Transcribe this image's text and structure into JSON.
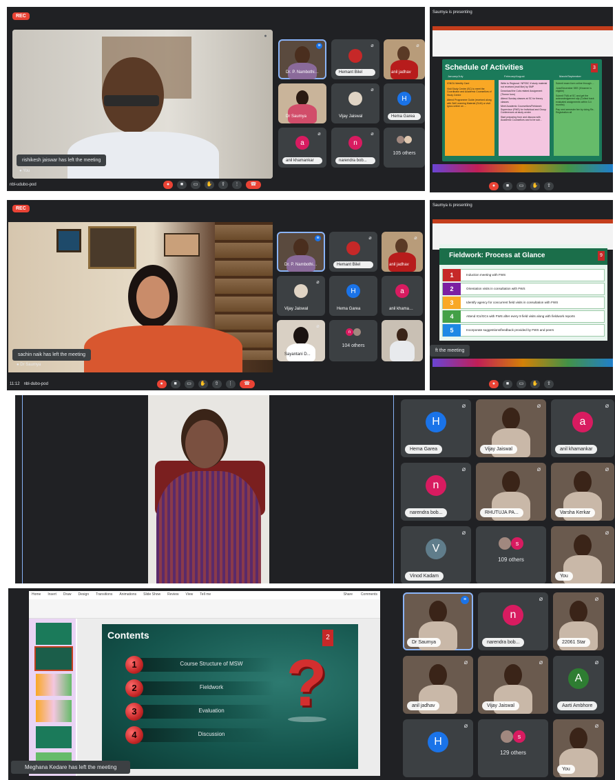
{
  "p1": {
    "rec": "REC",
    "toast": "rishikesh jaiswar has left the meeting",
    "self_label": "You",
    "footer": "nbl-udubo-pod",
    "tiles": [
      {
        "name": "Dr. P. Nambothiri...",
        "active": true
      },
      {
        "name": "Hemant Bilel",
        "avatar": "photo"
      },
      {
        "name": "anil jadhav"
      },
      {
        "name": "Dr Saumya"
      },
      {
        "name": "Vijay Jaiswal"
      },
      {
        "name": "Hema Garea",
        "letter": "H",
        "color": "#1a73e8"
      },
      {
        "name": "anil khamankar",
        "letter": "a",
        "color": "#d81b60"
      },
      {
        "name": "narendra bob...",
        "letter": "n",
        "color": "#d81b60"
      },
      {
        "name": "105 others"
      }
    ]
  },
  "p2": {
    "header": "Saumya is presenting",
    "slide_title": "Schedule of Activities",
    "columns": [
      "January/July",
      "February/August",
      "March/September"
    ],
    "col1": [
      "IGNOU Identity Card",
      "Visit Study Centre (SC) to meet the Coordinator and Academic Counsellors of Study Centre",
      "Attend Programme Guide (received along with Self Learning Material (SLM) or visit ignou online on ..."
    ],
    "col2": [
      "Write to Regional / NPSSC if study material not received (mail like) by SMP",
      "Download the Cuts related Assignment (Theme form)",
      "Attend Sunday classes at SC for theory classes",
      "Meet Academic Counsellors/Fieldwork Supervisor (FWS) for Individual and Group Conferences at study centre",
      "Start preparing from and discuss with Academic Counsellors and to be sub..."
    ],
    "col3": [
      "Submit exam form online through ...",
      "June/December SEE (if learner is eligible)",
      "Submit TMA at SC and get the acknowledgement slip (Collect back evaluated assignments within 3-4 months)",
      "Pay next semester fee by doing Re-Registration all"
    ],
    "slide_no": "3"
  },
  "p3": {
    "rec": "REC",
    "toast": "sachin naik has left the meeting",
    "self_label": "Dr Saumya",
    "time": "11:12",
    "footer": "nbl-dubo-pod",
    "tiles": [
      {
        "name": "Dr. P. Nambothiri...",
        "active": true
      },
      {
        "name": "Hemant Bilel",
        "avatar": "photo"
      },
      {
        "name": "anil jadhav"
      },
      {
        "name": "Vijay Jaiswal"
      },
      {
        "name": "Hema Garea",
        "letter": "H",
        "color": "#1a73e8"
      },
      {
        "name": "anil khamankar",
        "letter": "a",
        "color": "#d81b60"
      },
      {
        "name": "Sayantani D..."
      },
      {
        "name": "104 others"
      },
      {
        "name": ""
      }
    ]
  },
  "p4": {
    "header": "Saumya is presenting",
    "slide_title": "Fieldwork: Process at Glance",
    "slide_no": "9",
    "toast": "ft the meeting",
    "rows": [
      {
        "n": "1",
        "color": "#c62828",
        "text": "Induction meeting with FWS"
      },
      {
        "n": "2",
        "color": "#7b1fa2",
        "text": "Orientation visits in consultation with FWS"
      },
      {
        "n": "3",
        "color": "#f9a825",
        "text": "Identify agency for concurrent field visits in consultation with FWS"
      },
      {
        "n": "4",
        "color": "#43a047",
        "text": "Attend ICs/GCs with FWS after every 9 field visits along with fieldwork reports"
      },
      {
        "n": "5",
        "color": "#1e88e5",
        "text": "Incorporate suggestions/feedback provided by FWS and peers"
      }
    ]
  },
  "p5": {
    "tiles": [
      {
        "name": "Hema Garea",
        "letter": "H",
        "color": "#1a73e8"
      },
      {
        "name": "Vijay Jaiswal"
      },
      {
        "name": "anil khamankar",
        "letter": "a",
        "color": "#d81b60"
      },
      {
        "name": "narendra bob...",
        "letter": "n",
        "color": "#d81b60"
      },
      {
        "name": "RHUTUJA PA..."
      },
      {
        "name": "Varsha Kerkar"
      },
      {
        "name": "Vinod Kadam",
        "letter": "V",
        "color": "#607d8b"
      },
      {
        "name": "109 others"
      },
      {
        "name": "You"
      }
    ]
  },
  "p6": {
    "ribbon_tabs": [
      "Home",
      "Insert",
      "Draw",
      "Design",
      "Transitions",
      "Animations",
      "Slide Show",
      "Review",
      "View",
      "Tell me"
    ],
    "share": "Share",
    "comments": "Comments",
    "slide_title": "Contents",
    "slide_no": "2",
    "items": [
      {
        "n": "1",
        "text": "Course Structure of MSW"
      },
      {
        "n": "2",
        "text": "Fieldwork"
      },
      {
        "n": "3",
        "text": "Evaluation"
      },
      {
        "n": "4",
        "text": "Discussion"
      }
    ],
    "toast": "Meghana Kedare has left the meeting",
    "tiles": [
      {
        "name": "Dr Saumya",
        "active": true
      },
      {
        "name": "narendra bob...",
        "letter": "n",
        "color": "#d81b60"
      },
      {
        "name": "22061 Star"
      },
      {
        "name": "anil jadhav"
      },
      {
        "name": "Vijay Jaiswal"
      },
      {
        "name": "Aarti Ambhore",
        "letter": "A",
        "color": "#2e7d32"
      },
      {
        "name": "",
        "letter": "H",
        "color": "#1a73e8"
      },
      {
        "name": "129 others"
      },
      {
        "name": "You"
      }
    ]
  }
}
